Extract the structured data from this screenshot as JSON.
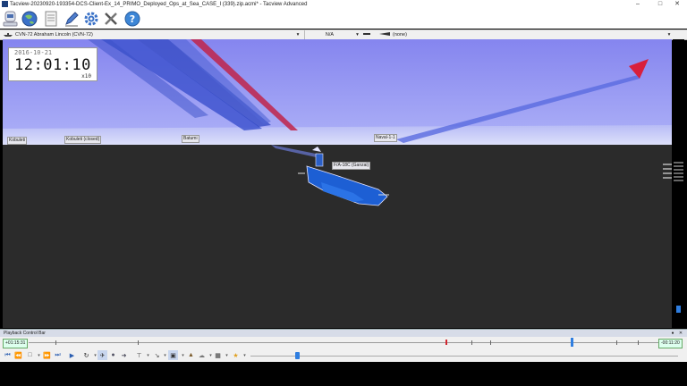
{
  "window": {
    "title": "Tacview-20230920-193354-DCS-Client-Ex_14_PRIMO_Deployed_Ops_at_Sea_CASE_I (339).zip.acmi* - Tacview Advanced"
  },
  "toolbar": {
    "icons": [
      "recorder-icon",
      "globe-icon",
      "document-icon",
      "edit-icon",
      "settings-gear-icon",
      "tools-icon",
      "help-icon"
    ]
  },
  "selection_bar": {
    "object": "CVN-72 Abraham Lincoln (CVN-72)",
    "target": "N/A",
    "secondary": "(none)"
  },
  "clock": {
    "date": "2016-10-21",
    "time": "12:01:10",
    "speed": "x10"
  },
  "scene_labels": {
    "kobuleti": "Kobuleti",
    "kobuleti_closed": "Kobuleti (closed)",
    "batumi": "Batumi",
    "naval": "Naval-1-1",
    "aircraft": "F/A-18C (Ganzai)"
  },
  "playback": {
    "bar_title": "Playback Control Bar",
    "elapsed": "+01:15:31",
    "remaining": "-00:11:20",
    "progress": 0.86
  },
  "colors": {
    "sky_top": "#8d8df0",
    "sky_horizon": "#d4d8f8",
    "ground": "#2b2b2b",
    "carrier": "#1d5fd4",
    "trail": "#3c58d8",
    "red_trail": "#d81f3c"
  }
}
